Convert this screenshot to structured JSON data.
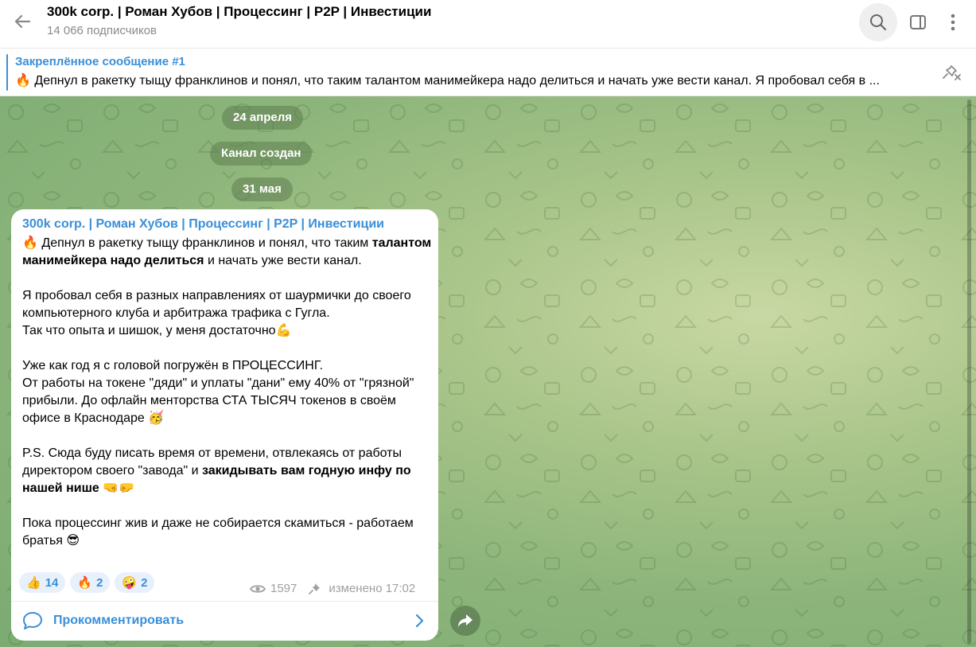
{
  "header": {
    "title": "300k corp. | Роман Хубов | Процессинг | P2P | Инвестиции",
    "subtitle": "14 066 подписчиков",
    "icons": {
      "back": "arrow-left-icon",
      "search": "search-icon",
      "sidebar": "sidebar-icon",
      "more": "more-vertical-icon"
    }
  },
  "pinned": {
    "title": "Закреплённое сообщение #1",
    "emoji": "🔥",
    "text": "Депнул в ракетку тыщу франклинов и понял, что таким талантом манимейкера надо делиться и начать уже вести канал.  Я пробовал себя в ..."
  },
  "chat": {
    "dates": [
      "24 апреля",
      "Канал создан",
      "31 мая"
    ]
  },
  "message": {
    "author": "300k corp. | Роман Хубов | Процессинг | P2P | Инвестиции",
    "p1_emoji": "🔥",
    "p1_a": " Депнул в ракетку тыщу франклинов и понял, что таким ",
    "p1_bold": "талантом манимейкера надо делиться",
    "p1_b": " и начать уже вести канал.",
    "p2_line1": "Я пробовал себя в разных направлениях от шаурмички до своего компьютерного клуба и арбитража трафика с Гугла.",
    "p2_line2": "Так что опыта и шишок, у меня достаточно",
    "p2_emoji": "💪",
    "p3_line1": "Уже как год я с головой погружён в ПРОЦЕССИНГ.",
    "p3_line2": "От работы на токене \"дяди\" и уплаты \"дани\" ему 40% от \"грязной\" прибыли. До офлайн менторства СТА ТЫСЯЧ токенов в своём офисе в Краснодаре",
    "p3_emoji": "🥳",
    "p4_a": "P.S. Сюда буду писать время от времени, отвлекаясь от работы директором своего \"завода\" и ",
    "p4_bold": "закидывать вам годную инфу по нашей нише",
    "p4_emoji": "🤜🤛",
    "p5_text": "Пока процессинг жив и даже не собирается скамиться - работаем братья",
    "p5_emoji": "😎",
    "reactions": [
      {
        "emoji": "👍",
        "count": "14"
      },
      {
        "emoji": "🔥",
        "count": "2"
      },
      {
        "emoji": "🤪",
        "count": "2"
      }
    ],
    "views": "1597",
    "edited": "изменено 17:02",
    "comment_label": "Прокомментировать"
  }
}
